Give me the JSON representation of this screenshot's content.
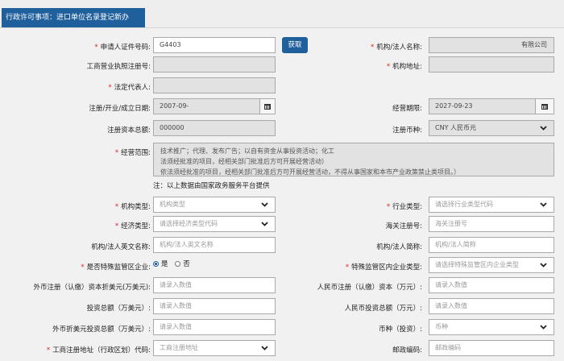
{
  "tab": {
    "title": "行政许可事项：进口单位名录登记新办"
  },
  "fields": {
    "cert_no": {
      "label": "申请人证件号码:",
      "value": "G4403"
    },
    "fetch_button": "获取",
    "org_name": {
      "label": "机构/法人名称:",
      "value": "有限公司"
    },
    "biz_reg_no": {
      "label": "工商营业执照注册号:",
      "value": ""
    },
    "org_address": {
      "label": "机构地址:",
      "value": ""
    },
    "legal_rep": {
      "label": "法定代表人:",
      "value": ""
    },
    "reg_date": {
      "label": "注册/开业/成立日期:",
      "value": "2007-09-"
    },
    "op_period": {
      "label": "经营期限:",
      "value": "2027-09-23"
    },
    "reg_capital": {
      "label": "注册资本总额:",
      "value": "000000"
    },
    "reg_currency": {
      "label": "注册币种:",
      "value": "CNY 人民币元"
    },
    "biz_scope": {
      "label": "经营范围:",
      "lines": [
        "技术推广；代理、发布广告；以自有资金从事投资活动；化工",
        "法须经批准的项目，经相关部门批准后方可开展经营活动）",
        "依法须经批准的项目，经相关部门批准后方可开展经营活动，不得从事国家和本市产业政策禁止类项目。）"
      ]
    },
    "note": "注：以上数据由国家政务服务平台提供",
    "org_type": {
      "label": "机构类型:",
      "placeholder": "机构类型"
    },
    "industry_type": {
      "label": "行业类型:",
      "placeholder": "请选择行业类型代码"
    },
    "econ_type": {
      "label": "经济类型:",
      "placeholder": "请选择经济类型代码"
    },
    "customs_no": {
      "label": "海关注册号:",
      "placeholder": "海关注册号"
    },
    "en_name": {
      "label": "机构/法人英文名称:",
      "placeholder": "机构/法人英文名称"
    },
    "short_name": {
      "label": "机构/法人简称:",
      "placeholder": "机构/法人简称"
    },
    "special_zone": {
      "label": "是否特殊监管区企业:",
      "yes": "是",
      "no": "否"
    },
    "special_zone_type": {
      "label": "特殊监管区内企业类型:",
      "placeholder": "请选择特殊监管区内企业类型"
    },
    "fx_capital_usd": {
      "label": "外币注册（认缴）资本折美元(万美元):",
      "placeholder": "请录入数值"
    },
    "rmb_capital": {
      "label": "人民币注册（认缴）资本（万元）:",
      "placeholder": "请录入数值"
    },
    "total_invest_usd": {
      "label": "投资总额（万美元）:",
      "placeholder": "请录入数值"
    },
    "rmb_invest": {
      "label": "人民币投资总额（万元）:",
      "placeholder": "请录入数值"
    },
    "fx_invest_usd": {
      "label": "外币折美元投资总额（万美元）:",
      "placeholder": "请录入数值"
    },
    "invest_currency": {
      "label": "币种（投资）:",
      "placeholder": "币种"
    },
    "reg_area": {
      "label": "工商注册地址（行政区划）代码:",
      "placeholder": "工商注册地址"
    },
    "postcode": {
      "label": "邮政编码:",
      "placeholder": "邮政编码"
    }
  },
  "colors": {
    "accent": "#1f5f9c",
    "required": "#d9261c"
  },
  "icons": {
    "calendar": "calendar-icon",
    "dropdown": "chevron-down-icon"
  }
}
